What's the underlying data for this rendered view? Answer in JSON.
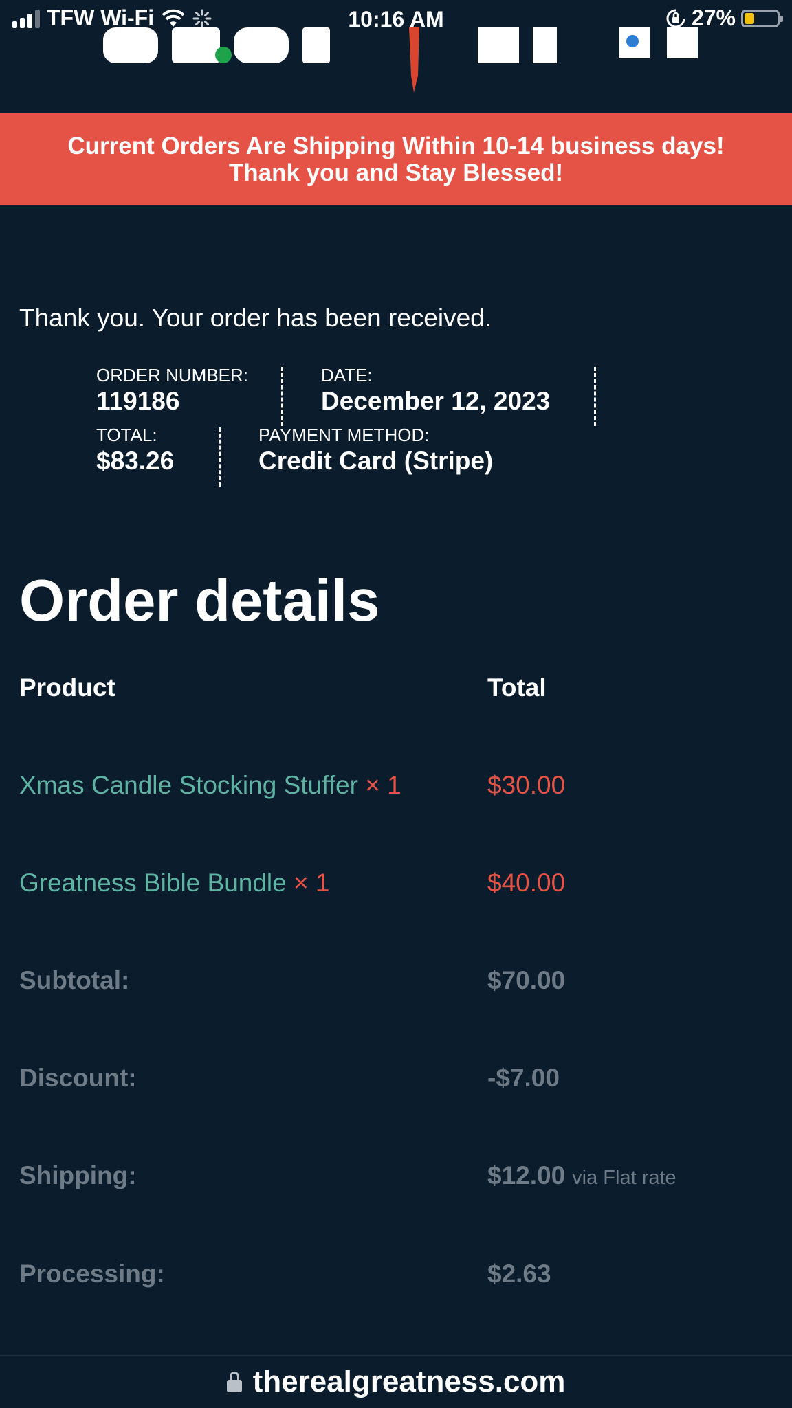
{
  "status_bar": {
    "carrier": "TFW Wi-Fi",
    "time": "10:16 AM",
    "battery": "27%",
    "battery_level": 0.27
  },
  "banner": {
    "line1": "Current Orders Are Shipping Within 10-14 business days!",
    "line2": "Thank you and Stay Blessed!"
  },
  "order": {
    "thanks_message": "Thank you. Your order has been received.",
    "number_label": "ORDER NUMBER:",
    "number": "119186",
    "date_label": "DATE:",
    "date": "December 12, 2023",
    "total_label": "TOTAL:",
    "total": "$83.26",
    "payment_label": "PAYMENT METHOD:",
    "payment": "Credit Card (Stripe)"
  },
  "details": {
    "title": "Order details",
    "col_product": "Product",
    "col_total": "Total",
    "items": [
      {
        "name": "Xmas Candle Stocking Stuffer",
        "qty": "× 1",
        "price": "$30.00"
      },
      {
        "name": "Greatness Bible Bundle",
        "qty": "× 1",
        "price": "$40.00"
      }
    ],
    "subtotal_label": "Subtotal:",
    "subtotal": "$70.00",
    "discount_label": "Discount:",
    "discount": "-$7.00",
    "shipping_label": "Shipping:",
    "shipping": "$12.00",
    "shipping_via": "via Flat rate",
    "processing_label": "Processing:",
    "processing": "$2.63"
  },
  "url_bar": {
    "url": "therealgreatness.com"
  },
  "colors": {
    "background": "#0b1d2d",
    "banner": "#e55347",
    "product_link": "#5fb3a3",
    "price": "#e55347",
    "muted": "#6e7a86"
  }
}
